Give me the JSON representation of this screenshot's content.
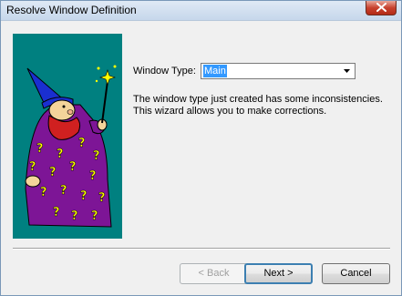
{
  "window": {
    "title": "Resolve Window Definition"
  },
  "form": {
    "window_type_label": "Window Type:",
    "window_type_value": "Main",
    "description": "The window type just created has some inconsistencies.  This wizard allows you to make corrections."
  },
  "buttons": {
    "back": "< Back",
    "next": "Next >",
    "cancel": "Cancel"
  },
  "icons": {
    "close": "close-icon",
    "dropdown": "chevron-down-icon",
    "wizard": "wizard-illustration"
  },
  "colors": {
    "wizard_background": "#008080",
    "robe": "#7d1596",
    "question_marks": "#ffff00",
    "selection": "#3399ff"
  }
}
